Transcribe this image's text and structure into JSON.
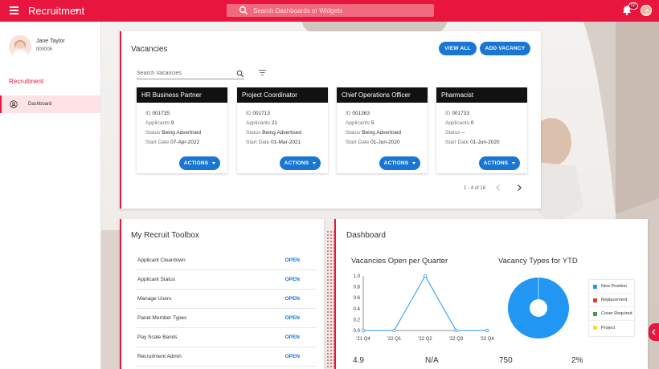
{
  "header": {
    "app_title": "Recruitment",
    "search_placeholder": "Search Dashboards or Widgets",
    "notification_count": "50"
  },
  "sidebar": {
    "user_name": "Jane Taylor",
    "user_id": "000005",
    "section": "Recruitment",
    "items": [
      {
        "label": "Dashboard"
      }
    ]
  },
  "vacancies": {
    "title": "Vacancies",
    "view_all": "VIEW ALL",
    "add_vacancy": "ADD VACANCY",
    "search_placeholder": "Search Vacancies",
    "actions_label": "ACTIONS",
    "labels": {
      "id": "ID",
      "applicants": "Applicants",
      "status": "Status",
      "start_date": "Start Date"
    },
    "items": [
      {
        "title": "HR Business Partner",
        "id": "001735",
        "applicants": "9",
        "status": "Being Advertised",
        "start_date": "07-Apr-2022"
      },
      {
        "title": "Project Coordinator",
        "id": "001713",
        "applicants": "21",
        "status": "Being Advertised",
        "start_date": "01-Mar-2021"
      },
      {
        "title": "Chief Operations Officer",
        "id": "001363",
        "applicants": "5",
        "status": "Being Advertised",
        "start_date": "01-Jun-2020"
      },
      {
        "title": "Pharmacist",
        "id": "001733",
        "applicants": "0",
        "status": "--",
        "start_date": "01-Jun-2020"
      }
    ],
    "pagination": "1 - 4 of 18"
  },
  "toolbox": {
    "title": "My Recruit Toolbox",
    "open_label": "OPEN",
    "items": [
      {
        "label": "Applicant Cleardown"
      },
      {
        "label": "Applicant Status"
      },
      {
        "label": "Manage Users"
      },
      {
        "label": "Panel Member Types"
      },
      {
        "label": "Pay Scale Bands"
      },
      {
        "label": "Recruitment Admin"
      }
    ]
  },
  "dashboard": {
    "title": "Dashboard",
    "stats": [
      "4.9",
      "N/A",
      "750",
      "2%"
    ]
  },
  "chart_data": [
    {
      "type": "line",
      "title": "Vacancies Open per Quarter",
      "categories": [
        "'21 Q4",
        "'22 Q1",
        "'22 Q2",
        "'22 Q3",
        "'22 Q4"
      ],
      "values": [
        0,
        0,
        1,
        0,
        0
      ],
      "ylim": [
        0,
        1
      ],
      "yticks": [
        "0.0",
        "0.2",
        "0.4",
        "0.6",
        "0.8",
        "1.0"
      ],
      "color": "#2196f3"
    },
    {
      "type": "pie",
      "title": "Vacancy Types for YTD",
      "labels": [
        "New Position",
        "Replacement",
        "Cover Required",
        "Project"
      ],
      "values": [
        100,
        0,
        0,
        0
      ],
      "colors": [
        "#2196f3",
        "#e53935",
        "#43a047",
        "#fdd835"
      ],
      "legend": "right"
    }
  ]
}
